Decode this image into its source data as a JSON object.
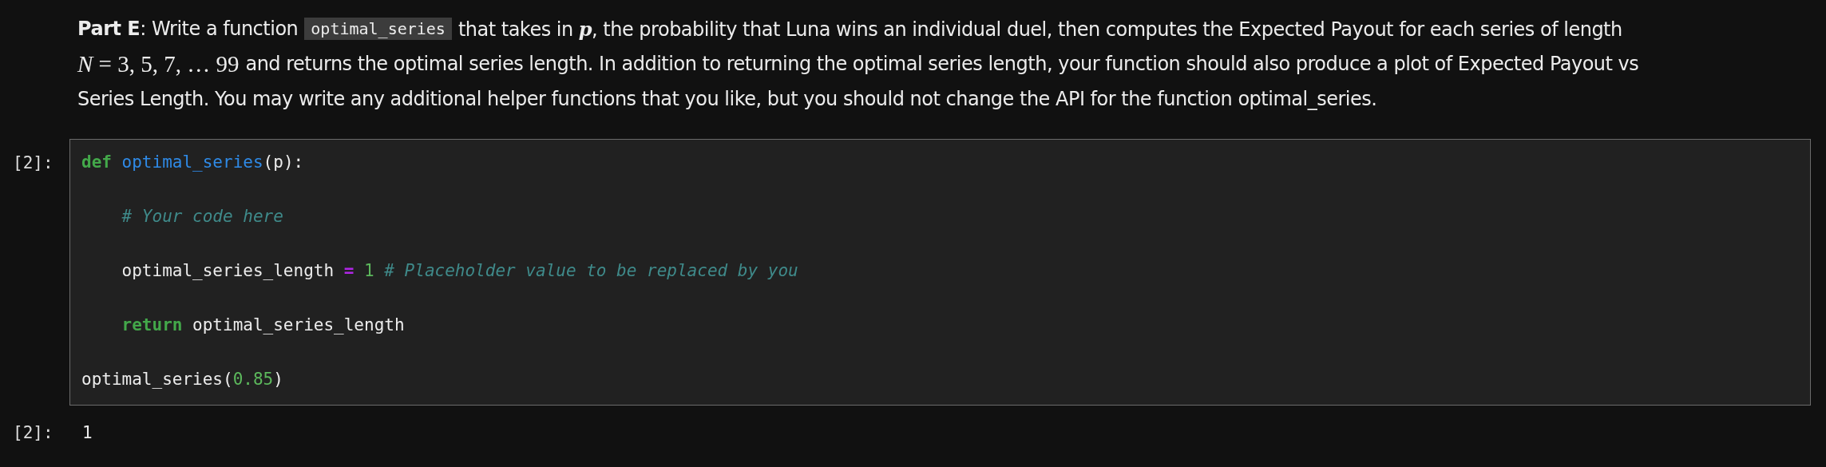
{
  "markdown_cell": {
    "lines": [
      [
        {
          "kind": "text",
          "text": "**Part E**: Write a function"
        },
        {
          "kind": "code",
          "text": "optimal_series"
        },
        {
          "kind": "text",
          "text": "that takes in *p*, the probability that Luna wins an individual duel, then computes the Expected Payout for each series of length"
        }
      ],
      [
        {
          "kind": "math",
          "text": "N = 3, 5, 7, … 99"
        },
        {
          "kind": "text",
          "text": "and returns the optimal series length. In addition to returning the optimal series length, your function should also produce a plot of Expected Payout vs"
        }
      ],
      [
        {
          "kind": "text",
          "text": "Series Length. You may write any additional helper functions that you like, but you should not change the API for the function optimal_series."
        }
      ]
    ]
  },
  "code_cell": {
    "prompt": "[2]:",
    "lines": [
      {
        "indented": false,
        "tokens": [
          {
            "kind": "keyword",
            "text": "def"
          },
          {
            "kind": "function",
            "text": "optimal_series",
            "space_before": true
          },
          {
            "kind": "plain",
            "text": "(p):"
          }
        ]
      },
      {
        "indented": true,
        "tokens": [
          {
            "kind": "comment",
            "text": "# Your code here"
          }
        ]
      },
      {
        "indented": true,
        "tokens": [
          {
            "kind": "plain",
            "text": "optimal_series_length"
          },
          {
            "kind": "operator",
            "text": "=",
            "space_before": true
          },
          {
            "kind": "number",
            "text": "1",
            "space_before": true
          },
          {
            "kind": "comment",
            "text": "# Placeholder value to be replaced by you",
            "space_before": true
          }
        ]
      },
      {
        "indented": true,
        "tokens": [
          {
            "kind": "keyword",
            "text": "return"
          },
          {
            "kind": "plain",
            "text": "optimal_series_length",
            "space_before": true
          }
        ]
      },
      {
        "indented": false,
        "tokens": [
          {
            "kind": "plain",
            "text": "optimal_series("
          },
          {
            "kind": "number",
            "text": "0.85"
          },
          {
            "kind": "plain",
            "text": ")"
          }
        ]
      }
    ]
  },
  "output": {
    "prompt": "[2]:",
    "value": "1"
  }
}
